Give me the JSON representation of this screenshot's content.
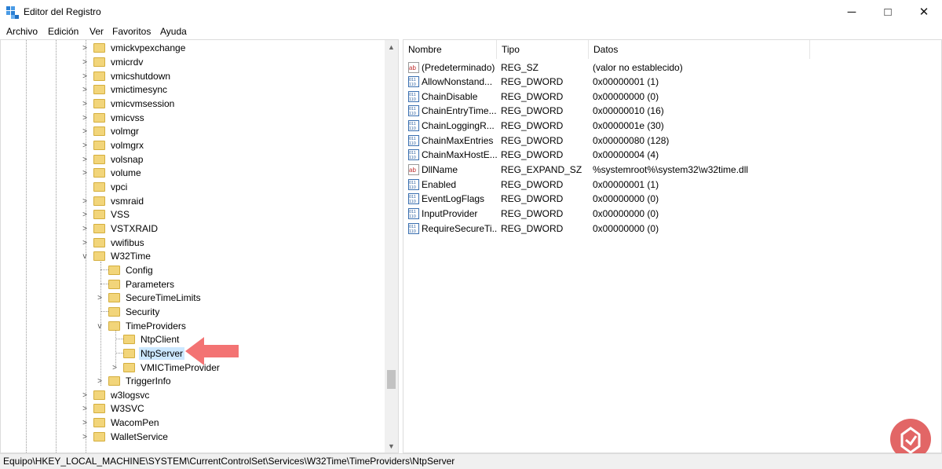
{
  "window": {
    "title": "Editor del Registro",
    "icon": "registry-icon",
    "controls": [
      "minimize-icon",
      "maximize-icon",
      "close-icon"
    ]
  },
  "menu": [
    "Archivo",
    "Edición",
    "Ver",
    "Favoritos",
    "Ayuda"
  ],
  "tree": {
    "items": [
      {
        "label": "vmickvpexchange",
        "level": 0,
        "expander": ">"
      },
      {
        "label": "vmicrdv",
        "level": 0,
        "expander": ">"
      },
      {
        "label": "vmicshutdown",
        "level": 0,
        "expander": ">"
      },
      {
        "label": "vmictimesync",
        "level": 0,
        "expander": ">"
      },
      {
        "label": "vmicvmsession",
        "level": 0,
        "expander": ">"
      },
      {
        "label": "vmicvss",
        "level": 0,
        "expander": ">"
      },
      {
        "label": "volmgr",
        "level": 0,
        "expander": ">"
      },
      {
        "label": "volmgrx",
        "level": 0,
        "expander": ">"
      },
      {
        "label": "volsnap",
        "level": 0,
        "expander": ">"
      },
      {
        "label": "volume",
        "level": 0,
        "expander": ">"
      },
      {
        "label": "vpci",
        "level": 0,
        "expander": ""
      },
      {
        "label": "vsmraid",
        "level": 0,
        "expander": ">"
      },
      {
        "label": "VSS",
        "level": 0,
        "expander": ">"
      },
      {
        "label": "VSTXRAID",
        "level": 0,
        "expander": ">"
      },
      {
        "label": "vwifibus",
        "level": 0,
        "expander": ">"
      },
      {
        "label": "W32Time",
        "level": 0,
        "expander": "v"
      },
      {
        "label": "Config",
        "level": 1,
        "expander": ""
      },
      {
        "label": "Parameters",
        "level": 1,
        "expander": ""
      },
      {
        "label": "SecureTimeLimits",
        "level": 1,
        "expander": ">"
      },
      {
        "label": "Security",
        "level": 1,
        "expander": ""
      },
      {
        "label": "TimeProviders",
        "level": 1,
        "expander": "v"
      },
      {
        "label": "NtpClient",
        "level": 2,
        "expander": ""
      },
      {
        "label": "NtpServer",
        "level": 2,
        "expander": "",
        "selected": true
      },
      {
        "label": "VMICTimeProvider",
        "level": 2,
        "expander": ">"
      },
      {
        "label": "TriggerInfo",
        "level": 1,
        "expander": ">"
      },
      {
        "label": "w3logsvc",
        "level": 0,
        "expander": ">"
      },
      {
        "label": "W3SVC",
        "level": 0,
        "expander": ">"
      },
      {
        "label": "WacomPen",
        "level": 0,
        "expander": ">"
      },
      {
        "label": "WalletService",
        "level": 0,
        "expander": ">"
      }
    ]
  },
  "list": {
    "columns": [
      "Nombre",
      "Tipo",
      "Datos"
    ],
    "rows": [
      {
        "name": "(Predeterminado)",
        "type": "REG_SZ",
        "data": "(valor no establecido)",
        "icon": "string-value-icon"
      },
      {
        "name": "AllowNonstand...",
        "type": "REG_DWORD",
        "data": "0x00000001 (1)",
        "icon": "binary-value-icon"
      },
      {
        "name": "ChainDisable",
        "type": "REG_DWORD",
        "data": "0x00000000 (0)",
        "icon": "binary-value-icon"
      },
      {
        "name": "ChainEntryTime...",
        "type": "REG_DWORD",
        "data": "0x00000010 (16)",
        "icon": "binary-value-icon"
      },
      {
        "name": "ChainLoggingR...",
        "type": "REG_DWORD",
        "data": "0x0000001e (30)",
        "icon": "binary-value-icon"
      },
      {
        "name": "ChainMaxEntries",
        "type": "REG_DWORD",
        "data": "0x00000080 (128)",
        "icon": "binary-value-icon"
      },
      {
        "name": "ChainMaxHostE...",
        "type": "REG_DWORD",
        "data": "0x00000004 (4)",
        "icon": "binary-value-icon"
      },
      {
        "name": "DllName",
        "type": "REG_EXPAND_SZ",
        "data": "%systemroot%\\system32\\w32time.dll",
        "icon": "string-value-icon"
      },
      {
        "name": "Enabled",
        "type": "REG_DWORD",
        "data": "0x00000001 (1)",
        "icon": "binary-value-icon"
      },
      {
        "name": "EventLogFlags",
        "type": "REG_DWORD",
        "data": "0x00000000 (0)",
        "icon": "binary-value-icon"
      },
      {
        "name": "InputProvider",
        "type": "REG_DWORD",
        "data": "0x00000000 (0)",
        "icon": "binary-value-icon"
      },
      {
        "name": "RequireSecureTi...",
        "type": "REG_DWORD",
        "data": "0x00000000 (0)",
        "icon": "binary-value-icon"
      }
    ]
  },
  "status": {
    "path": "Equipo\\HKEY_LOCAL_MACHINE\\SYSTEM\\CurrentControlSet\\Services\\W32Time\\TimeProviders\\NtpServer"
  },
  "colors": {
    "selection": "#cce8ff",
    "folder": "#f2d57a",
    "arrow": "#f26b6b",
    "logo": "#dd4b4b"
  },
  "annotation": {
    "icon": "pointer-arrow-icon"
  },
  "watermark": {
    "icon": "solvetic-logo-icon"
  }
}
